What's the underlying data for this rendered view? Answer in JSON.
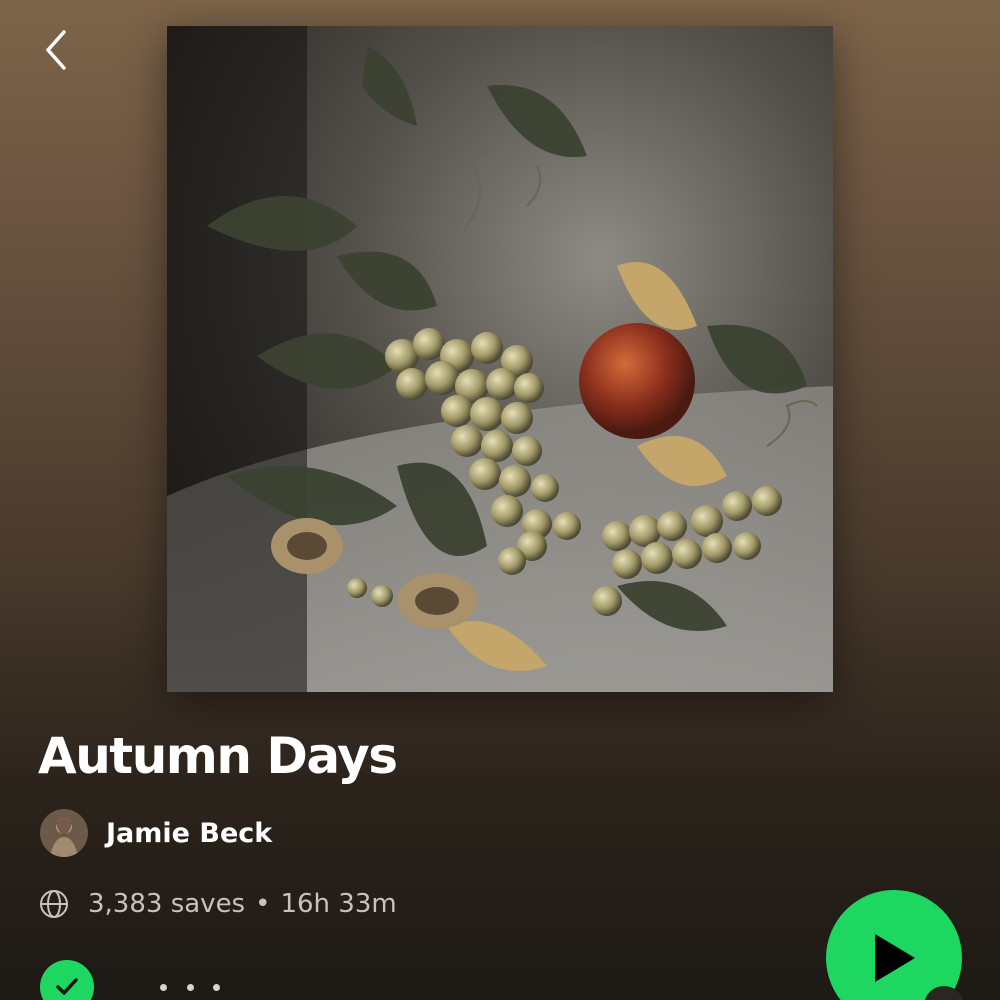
{
  "header": {
    "back_icon": "chevron-left-icon"
  },
  "playlist": {
    "title": "Autumn Days",
    "cover_description_icon": "playlist-cover-image",
    "owner": {
      "name": "Jamie Beck",
      "avatar_icon": "avatar"
    },
    "meta": {
      "visibility_icon": "globe-icon",
      "saves": "3,383 saves",
      "separator": "•",
      "duration": "16h 33m"
    }
  },
  "actions": {
    "saved_icon": "checkmark-icon",
    "more_icon": "more-options-icon",
    "play_icon": "play-icon"
  },
  "colors": {
    "accent": "#1ed760",
    "text_secondary": "#c9c2ba",
    "bg_top": "#7d6449",
    "bg_bottom": "#1d1915"
  }
}
